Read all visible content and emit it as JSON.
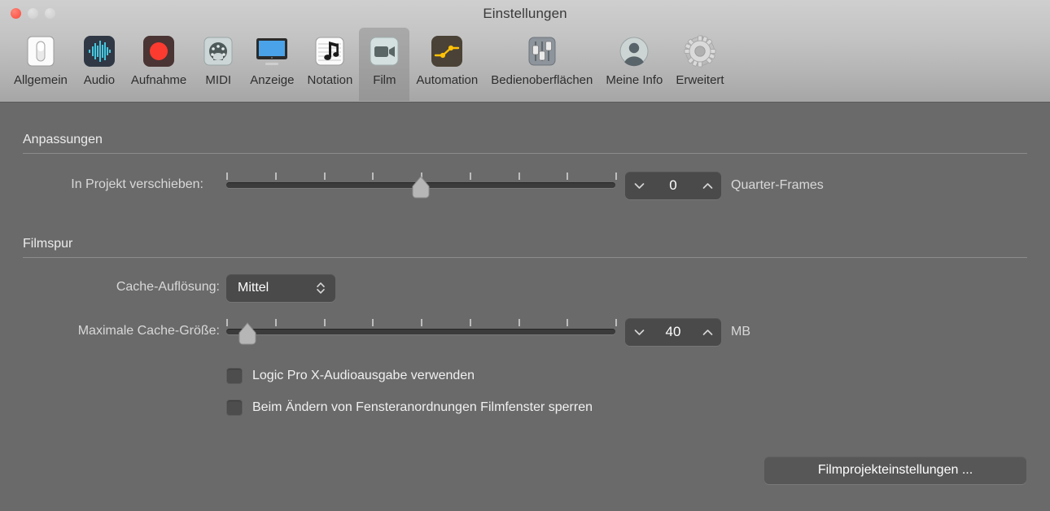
{
  "window": {
    "title": "Einstellungen",
    "traffic_lights": [
      {
        "name": "close",
        "color": "#fc5b4d"
      },
      {
        "name": "minimize",
        "color": "#d3d3d3"
      },
      {
        "name": "maximize",
        "color": "#d3d3d3"
      }
    ]
  },
  "toolbar": {
    "selected": "Film",
    "tabs": [
      {
        "label": "Allgemein",
        "icon": "switch-icon"
      },
      {
        "label": "Audio",
        "icon": "waveform-icon"
      },
      {
        "label": "Aufnahme",
        "icon": "record-icon"
      },
      {
        "label": "MIDI",
        "icon": "midi-connector-icon"
      },
      {
        "label": "Anzeige",
        "icon": "display-icon"
      },
      {
        "label": "Notation",
        "icon": "music-note-icon"
      },
      {
        "label": "Film",
        "icon": "video-camera-icon"
      },
      {
        "label": "Automation",
        "icon": "automation-curve-icon"
      },
      {
        "label": "Bedienoberflächen",
        "icon": "faders-icon"
      },
      {
        "label": "Meine Info",
        "icon": "user-avatar-icon"
      },
      {
        "label": "Erweitert",
        "icon": "gear-icon"
      }
    ]
  },
  "sections": [
    {
      "title": "Anpassungen",
      "rows": [
        {
          "label": "In Projekt verschieben:",
          "control": "slider-with-stepper",
          "slider": {
            "ticks": 9,
            "value_percent": 50
          },
          "stepper": {
            "value": "0",
            "down_icon": "chevron-down-icon",
            "up_icon": "chevron-up-icon"
          },
          "unit": "Quarter-Frames"
        }
      ]
    },
    {
      "title": "Filmspur",
      "rows": [
        {
          "label": "Cache-Auflösung:",
          "control": "popup",
          "popup": {
            "value": "Mittel",
            "indicator_icon": "chevron-up-down-icon"
          }
        },
        {
          "label": "Maximale Cache-Größe:",
          "control": "slider-with-stepper",
          "slider": {
            "ticks": 9,
            "value_percent": 3
          },
          "stepper": {
            "value": "40",
            "down_icon": "chevron-down-icon",
            "up_icon": "chevron-up-icon"
          },
          "unit": "MB"
        }
      ]
    }
  ],
  "checkboxes": [
    {
      "label": "Logic Pro X-Audioausgabe verwenden",
      "checked": false
    },
    {
      "label": "Beim Ändern von Fensteranordnungen Filmfenster sperren",
      "checked": false
    }
  ],
  "buttons": {
    "movie_project_settings": "Filmprojekteinstellungen ..."
  },
  "colors": {
    "content_background": "#6a6a6a",
    "chrome_background": "#c3c3c3",
    "accent_record": "#fb3b30",
    "accent_automation": "#ffc107",
    "slider_track": "#3b3b3b",
    "text_primary": "#f0f0f0",
    "text_secondary": "#d8d8d8"
  }
}
